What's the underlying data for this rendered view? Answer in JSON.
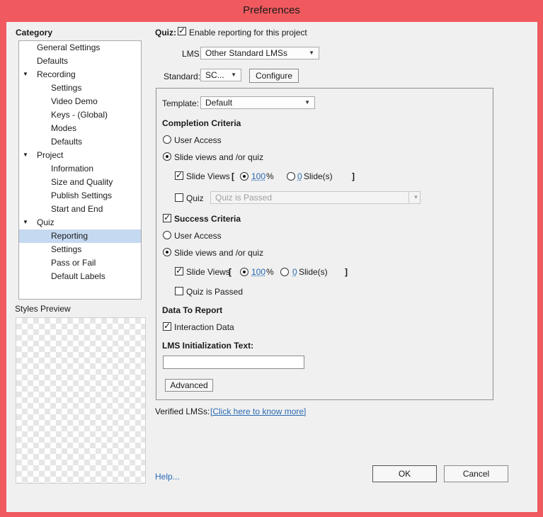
{
  "window": {
    "title": "Preferences"
  },
  "sidebar": {
    "category_label": "Category",
    "items": [
      {
        "label": "General Settings",
        "level": 0,
        "expander": ""
      },
      {
        "label": "Defaults",
        "level": 0,
        "expander": ""
      },
      {
        "label": "Recording",
        "level": 0,
        "expander": "▼"
      },
      {
        "label": "Settings",
        "level": 1,
        "expander": ""
      },
      {
        "label": "Video Demo",
        "level": 1,
        "expander": ""
      },
      {
        "label": "Keys - (Global)",
        "level": 1,
        "expander": ""
      },
      {
        "label": "Modes",
        "level": 1,
        "expander": ""
      },
      {
        "label": "Defaults",
        "level": 1,
        "expander": ""
      },
      {
        "label": "Project",
        "level": 0,
        "expander": "▼"
      },
      {
        "label": "Information",
        "level": 1,
        "expander": ""
      },
      {
        "label": "Size and Quality",
        "level": 1,
        "expander": ""
      },
      {
        "label": "Publish Settings",
        "level": 1,
        "expander": ""
      },
      {
        "label": "Start and End",
        "level": 1,
        "expander": ""
      },
      {
        "label": "Quiz",
        "level": 0,
        "expander": "▼"
      },
      {
        "label": "Reporting",
        "level": 1,
        "expander": "",
        "selected": true
      },
      {
        "label": "Settings",
        "level": 1,
        "expander": ""
      },
      {
        "label": "Pass or Fail",
        "level": 1,
        "expander": ""
      },
      {
        "label": "Default Labels",
        "level": 1,
        "expander": ""
      }
    ],
    "styles_preview_label": "Styles Preview"
  },
  "quiz": {
    "label": "Quiz:",
    "enable_reporting_label": "Enable reporting for this project",
    "enable_reporting_checked": true
  },
  "lms": {
    "label": "LMS:",
    "value": "Other Standard LMSs"
  },
  "standard": {
    "label": "Standard:",
    "value": "SC...",
    "configure_label": "Configure"
  },
  "template": {
    "label": "Template:",
    "value": "Default"
  },
  "completion": {
    "heading": "Completion Criteria",
    "user_access_label": "User Access",
    "slide_views_quiz_label": "Slide views and /or quiz",
    "slide_views_label": "Slide Views",
    "bracket_open": "[",
    "bracket_close": "]",
    "percent_value": "100",
    "percent_unit": "%",
    "slides_value": "0",
    "slides_unit": "Slide(s)",
    "quiz_label": "Quiz",
    "quiz_condition": "Quiz is Passed"
  },
  "success": {
    "heading": "Success Criteria",
    "user_access_label": "User Access",
    "slide_views_quiz_label": "Slide views and /or quiz",
    "slide_views_label": "Slide Views",
    "bracket_open": "[",
    "bracket_close": "]",
    "percent_value": "100",
    "percent_unit": "%",
    "slides_value": "0",
    "slides_unit": "Slide(s)",
    "quiz_passed_label": "Quiz is Passed"
  },
  "data_to_report": {
    "heading": "Data To Report",
    "interaction_data_label": "Interaction Data"
  },
  "lms_init": {
    "heading": "LMS Initialization Text:",
    "value": ""
  },
  "advanced_label": "Advanced",
  "verified": {
    "label": "Verified LMSs:",
    "link": "[Click here to know more]"
  },
  "footer": {
    "help": "Help...",
    "ok": "OK",
    "cancel": "Cancel"
  },
  "colors": {
    "titlebar": "#f05a5f",
    "panel": "#f0f0f0",
    "selection": "#c5d9f1",
    "link": "#2a6ab3"
  }
}
